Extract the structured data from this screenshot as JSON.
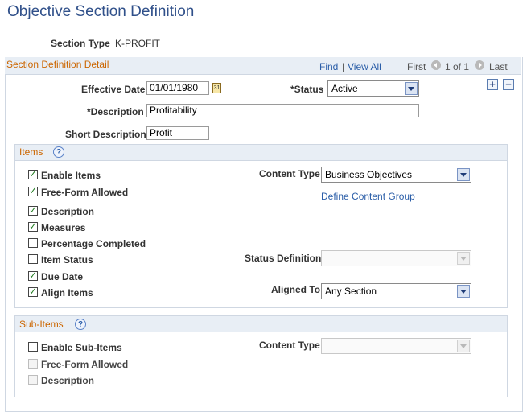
{
  "page": {
    "title": "Objective Section Definition"
  },
  "section_type": {
    "label": "Section Type",
    "value": "K-PROFIT"
  },
  "detail": {
    "title": "Section Definition Detail",
    "nav": {
      "find": "Find",
      "separator": "|",
      "view_all": "View All",
      "first": "First",
      "count": "1 of 1",
      "last": "Last"
    },
    "effective_date": {
      "label": "Effective Date",
      "value": "01/01/1980"
    },
    "status": {
      "label": "*Status",
      "value": "Active"
    },
    "description": {
      "label": "*Description",
      "value": "Profitability"
    },
    "short_description": {
      "label": "Short Description",
      "value": "Profit"
    }
  },
  "items": {
    "title": "Items",
    "checkboxes": [
      {
        "label": "Enable Items",
        "checked": true
      },
      {
        "label": "Free-Form Allowed",
        "checked": true
      },
      {
        "label": "Description",
        "checked": true
      },
      {
        "label": "Measures",
        "checked": true
      },
      {
        "label": "Percentage Completed",
        "checked": false
      },
      {
        "label": "Item Status",
        "checked": false
      },
      {
        "label": "Due Date",
        "checked": true
      },
      {
        "label": "Align Items",
        "checked": true
      }
    ],
    "content_type": {
      "label": "Content Type",
      "value": "Business Objectives"
    },
    "define_content_group": "Define Content Group",
    "status_definition": {
      "label": "Status Definition",
      "value": ""
    },
    "aligned_to": {
      "label": "Aligned To",
      "value": "Any Section"
    }
  },
  "sub_items": {
    "title": "Sub-Items",
    "checkboxes": [
      {
        "label": "Enable Sub-Items",
        "checked": false
      },
      {
        "label": "Free-Form Allowed",
        "checked": false
      },
      {
        "label": "Description",
        "checked": false
      }
    ],
    "content_type": {
      "label": "Content Type",
      "value": ""
    }
  },
  "icons": {
    "help": "help-icon",
    "calendar": "calendar-icon",
    "add_row": "add-row-icon",
    "delete_row": "delete-row-icon",
    "prev": "previous-arrow-icon",
    "next": "next-arrow-icon",
    "dropdown": "chevron-down-icon"
  },
  "colors": {
    "title": "#30508a",
    "section_title": "#cc6600",
    "link": "#2b5ea8",
    "header_bg": "#e8eef5",
    "check": "#1d7a1d"
  }
}
